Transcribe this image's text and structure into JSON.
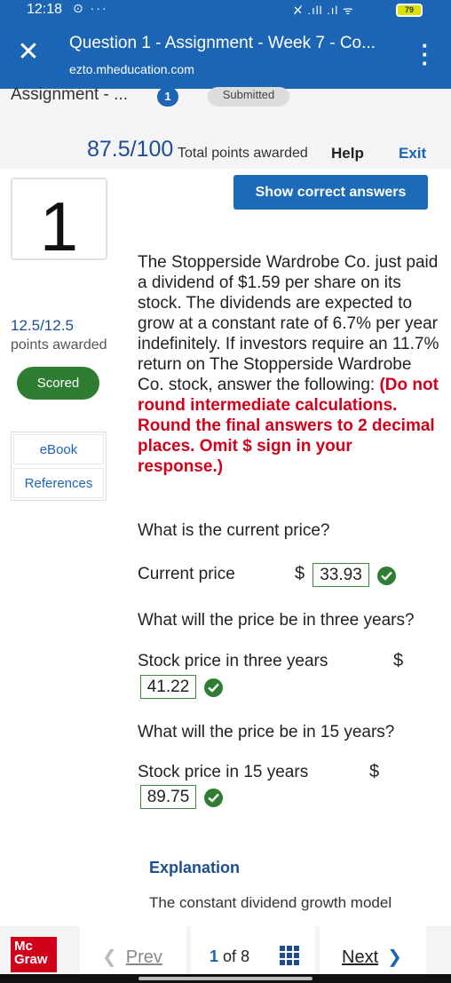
{
  "status_bar": {
    "time": "12:18",
    "left_icons": "⊙ ···",
    "right_icons": "✕̸ .ıll .ıl ᯤ",
    "battery": "79"
  },
  "browser": {
    "title": "Question 1 - Assignment - Week 7 - Co...",
    "url": "ezto.mheducation.com"
  },
  "assignment": {
    "name": "Assignment - ...",
    "question_badge": "1",
    "status": "Submitted",
    "score": "87.5/100",
    "score_label": "Total points awarded",
    "help": "Help",
    "exit": "Exit"
  },
  "question": {
    "number": "1",
    "points_value": "12.5/12.5",
    "points_label": "points awarded",
    "scored": "Scored",
    "ebook": "eBook",
    "references": "References",
    "show_answers": "Show correct answers",
    "text_main": "The Stopperside Wardrobe Co. just paid a dividend of $1.59 per share on its stock. The dividends are expected to grow at a constant rate of 6.7% per year indefinitely. If investors require an 11.7% return on The Stopperside Wardrobe Co. stock, answer the following: ",
    "text_instructions": "(Do not round intermediate calculations. Round the final answers to 2 decimal places. Omit $ sign in your response.)",
    "parts": [
      {
        "prompt": "What is the current price?",
        "label": "Current price",
        "currency": "$",
        "answer": "33.93"
      },
      {
        "prompt": "What will the price be in three years?",
        "label": "Stock price in three years",
        "currency": "$",
        "answer": "41.22"
      },
      {
        "prompt": "What will the price be in 15 years?",
        "label": "Stock price in 15 years",
        "currency": "$",
        "answer": "89.75"
      }
    ],
    "explanation_heading": "Explanation",
    "explanation_text": "The constant dividend growth model"
  },
  "footer": {
    "logo_line1": "Mc",
    "logo_line2": "Graw",
    "prev": "Prev",
    "current_page": "1",
    "of": "of",
    "total_pages": "8",
    "next": "Next"
  },
  "colors": {
    "brand_blue": "#1c64b4",
    "score_blue": "#1c4f8e",
    "correct_green": "#2f7d32",
    "instruction_red": "#d0021b"
  }
}
